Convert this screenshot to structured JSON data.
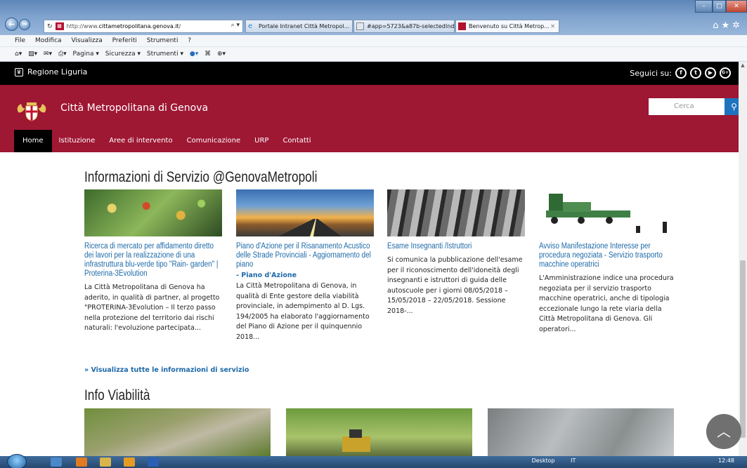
{
  "browser": {
    "url_prefix": "http://www.",
    "url_domain": "cittametropolitana.genova.it",
    "url_suffix": "/",
    "search_glyph": "⌕ ▾",
    "tabs": [
      {
        "label": "Portale Intranet Città Metropol..."
      },
      {
        "label": "#app=5723&a87b-selectedInd..."
      },
      {
        "label": "Benvenuto su Città Metrop..."
      }
    ],
    "menu": [
      "File",
      "Modifica",
      "Visualizza",
      "Preferiti",
      "Strumenti",
      "?"
    ],
    "commands": [
      "Pagina ▾",
      "Sicurezza ▾",
      "Strumenti ▾"
    ],
    "top_icons": "⌂★✲"
  },
  "topbar": {
    "region_label": "Regione Liguria",
    "follow_label": "Seguici su:",
    "social": [
      {
        "icon": "facebook-icon",
        "glyph": "f"
      },
      {
        "icon": "twitter-icon",
        "glyph": "t"
      },
      {
        "icon": "youtube-icon",
        "glyph": "▶"
      },
      {
        "icon": "googleplus-icon",
        "glyph": "G+"
      }
    ]
  },
  "header": {
    "site_title": "Città Metropolitana di Genova",
    "search_placeholder": "Cerca",
    "search_button": "Q",
    "nav": [
      "Home",
      "Istituzione",
      "Aree di intervento",
      "Comunicazione",
      "URP",
      "Contatti"
    ]
  },
  "informazioni": {
    "title": "Informazioni di Servizio @GenovaMetropoli",
    "cards": [
      {
        "title": "Ricerca di mercato per affidamento diretto dei lavori per la realizzazione di una infrastruttura blu-verde tipo \"Rain- garden\" | Proterina-3Evolution",
        "subtitle": "",
        "body": "La Città Metropolitana di Genova ha aderito, in qualità di partner, al progetto \"PROTERINA-3Evolution – Il terzo passo nella protezione del territorio dai rischi naturali: l'evoluzione partecipata..."
      },
      {
        "title": "Piano d'Azione per il Risanamento Acustico delle Strade Provinciali - Aggiornamento del piano",
        "subtitle": "- Piano d'Azione",
        "body": "La Città Metropolitana di Genova, in qualità di Ente gestore della viabilità provinciale, in adempimento al D. Lgs. 194/2005 ha elaborato l'aggiornamento del Piano di Azione per il quinquennio 2018..."
      },
      {
        "title": "Esame Insegnanti /Istruttori",
        "subtitle": "",
        "body": "Si comunica la pubblicazione dell'esame per il riconoscimento dell'idoneità degli insegnanti e istruttori di guida delle autoscuole per i giorni 08/05/2018 – 15/05/2018 – 22/05/2018. Sessione 2018-..."
      },
      {
        "title": "Avviso Manifestazione Interesse per procedura negoziata - Servizio trasporto macchine operatrici",
        "subtitle": "",
        "body": "L'Amministrazione indice una procedura negoziata per il servizio trasporto macchine operatrici, anche di tipologia eccezionale lungo la rete viaria della Città Metropolitana di Genova. Gli operatori..."
      }
    ],
    "more_link": "» Visualizza tutte le informazioni di servizio"
  },
  "viabilita": {
    "title": "Info Viabilità"
  },
  "to_top_glyph": "︿",
  "taskbar": {
    "desktop_label": "Desktop",
    "lang": "IT",
    "clock": "12:48"
  }
}
